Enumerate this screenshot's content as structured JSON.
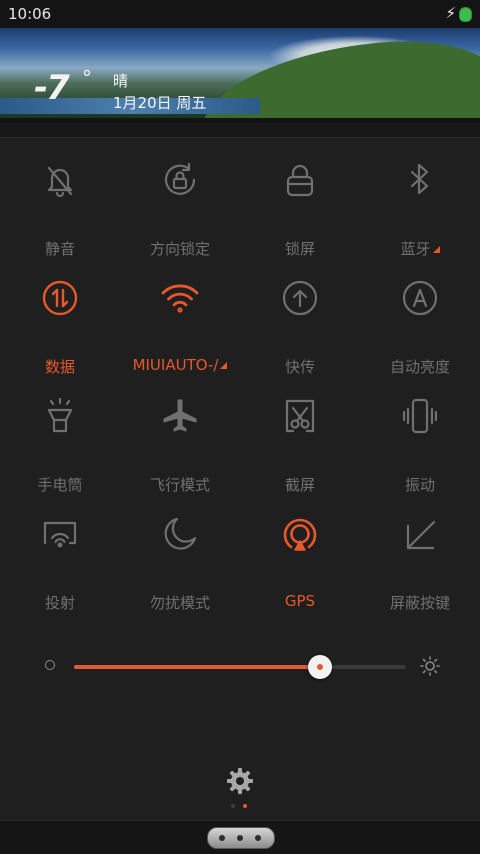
{
  "status_bar": {
    "time": "10:06",
    "charging_icon": "bolt-icon",
    "battery_icon": "battery-icon"
  },
  "weather": {
    "temperature": "-7",
    "degree_symbol": "°",
    "condition": "晴",
    "date": "1月20日 周五"
  },
  "toggles": [
    {
      "label": "静音",
      "icon": "bell-off-icon",
      "active": false
    },
    {
      "label": "方向锁定",
      "icon": "rotation-lock-icon",
      "active": false
    },
    {
      "label": "锁屏",
      "icon": "lock-icon",
      "active": false
    },
    {
      "label": "蓝牙",
      "icon": "bluetooth-icon",
      "active": false,
      "has_more": true
    },
    {
      "label": "数据",
      "icon": "mobile-data-icon",
      "active": true
    },
    {
      "label": "MIUIAUTO-/",
      "icon": "wifi-icon",
      "active": true,
      "has_more": true
    },
    {
      "label": "快传",
      "icon": "quick-transfer-icon",
      "active": false
    },
    {
      "label": "自动亮度",
      "icon": "auto-brightness-icon",
      "active": false
    },
    {
      "label": "手电筒",
      "icon": "flashlight-icon",
      "active": false
    },
    {
      "label": "飞行模式",
      "icon": "airplane-icon",
      "active": false
    },
    {
      "label": "截屏",
      "icon": "screenshot-icon",
      "active": false
    },
    {
      "label": "振动",
      "icon": "vibrate-icon",
      "active": false
    },
    {
      "label": "投射",
      "icon": "cast-icon",
      "active": false
    },
    {
      "label": "勿扰模式",
      "icon": "moon-icon",
      "active": false
    },
    {
      "label": "GPS",
      "icon": "gps-icon",
      "active": true
    },
    {
      "label": "屏蔽按键",
      "icon": "block-keys-icon",
      "active": false
    }
  ],
  "brightness": {
    "level": 0.74,
    "min_icon": "brightness-low-icon",
    "max_icon": "brightness-high-icon"
  },
  "colors": {
    "accent": "#e8582a",
    "inactive": "#707070",
    "background": "#1f1f1f"
  },
  "pager": {
    "pages": 2,
    "current": 2
  },
  "settings_icon": "gear-icon"
}
